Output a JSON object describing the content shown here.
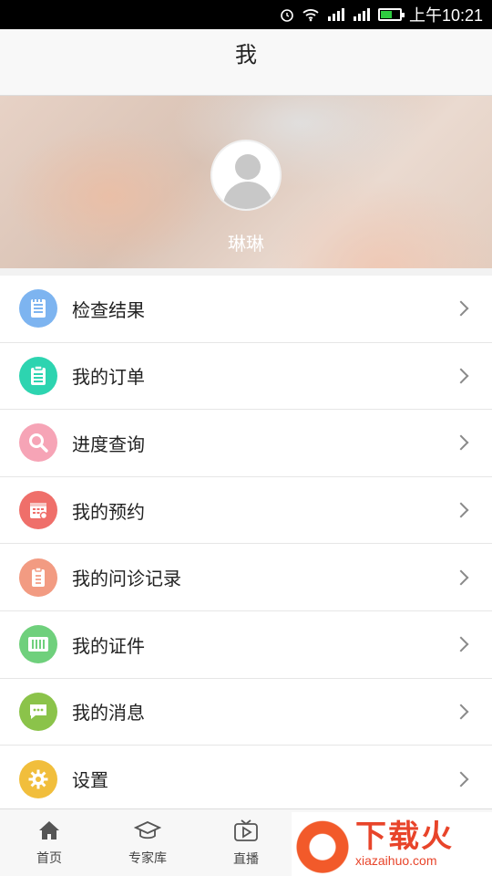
{
  "status_bar": {
    "time": "上午10:21",
    "battery_level": 0.6
  },
  "title": "我",
  "profile": {
    "username": "琳琳"
  },
  "menu": [
    {
      "label": "检查结果",
      "icon": "report-icon",
      "color": "#7db4f0"
    },
    {
      "label": "我的订单",
      "icon": "order-clipboard-icon",
      "color": "#2dd4b0"
    },
    {
      "label": "进度查询",
      "icon": "search-icon",
      "color": "#f6a4b6"
    },
    {
      "label": "我的预约",
      "icon": "calendar-icon",
      "color": "#ef6f6a"
    },
    {
      "label": "我的问诊记录",
      "icon": "clipboard-icon",
      "color": "#f29b82"
    },
    {
      "label": "我的证件",
      "icon": "id-card-icon",
      "color": "#6fd07c"
    },
    {
      "label": "我的消息",
      "icon": "message-icon",
      "color": "#8bc34a"
    },
    {
      "label": "设置",
      "icon": "gear-icon",
      "color": "#f1be3c"
    }
  ],
  "bottom_nav": [
    {
      "label": "首页",
      "icon": "home-icon"
    },
    {
      "label": "专家库",
      "icon": "graduation-cap-icon"
    },
    {
      "label": "直播",
      "icon": "tv-play-icon"
    }
  ],
  "watermark": {
    "title": "下载火",
    "url": "xiazaihuo.com"
  }
}
